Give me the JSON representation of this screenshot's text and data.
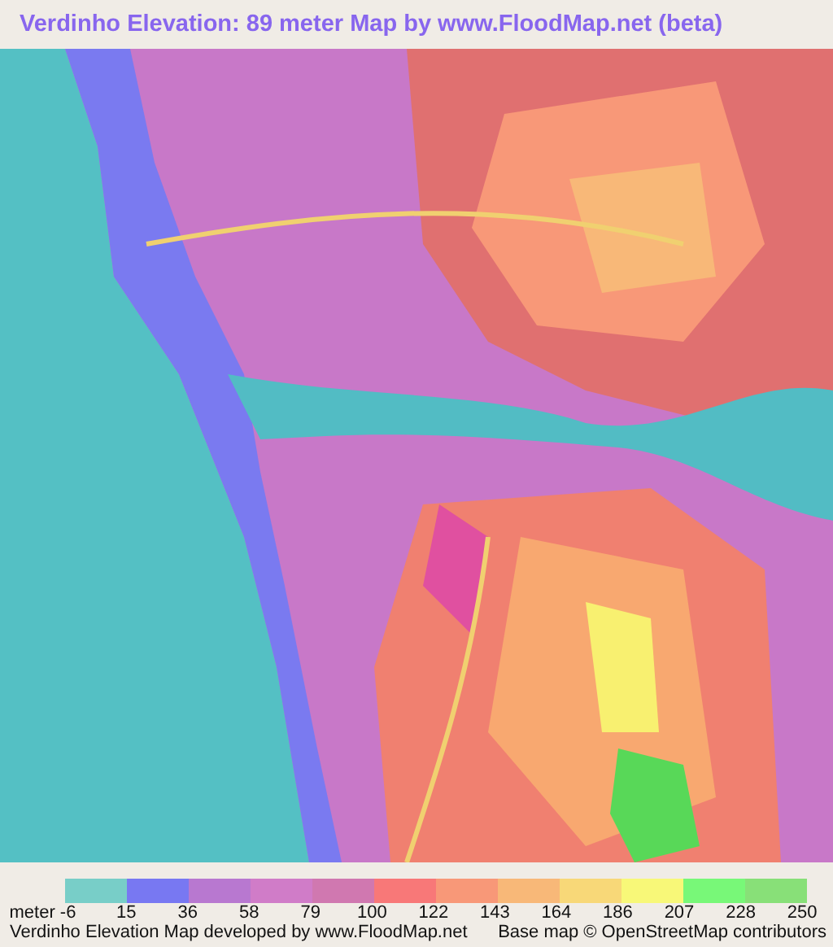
{
  "title": "Verdinho Elevation: 89 meter Map by www.FloodMap.net (beta)",
  "legend": {
    "swatches": [
      {
        "color": "#78cec8"
      },
      {
        "color": "#7878f2"
      },
      {
        "color": "#b878d0"
      },
      {
        "color": "#d07cc8"
      },
      {
        "color": "#d078b0"
      },
      {
        "color": "#f87878"
      },
      {
        "color": "#f89878"
      },
      {
        "color": "#f8b878"
      },
      {
        "color": "#f8d878"
      },
      {
        "color": "#f8f878"
      },
      {
        "color": "#78f878"
      },
      {
        "color": "#88e078"
      }
    ],
    "ticks": [
      "meter -6",
      "15",
      "36",
      "58",
      "79",
      "100",
      "122",
      "143",
      "164",
      "186",
      "207",
      "228",
      "250"
    ]
  },
  "footer": {
    "left": "Verdinho Elevation Map developed by www.FloodMap.net",
    "right": "Base map © OpenStreetMap contributors"
  }
}
